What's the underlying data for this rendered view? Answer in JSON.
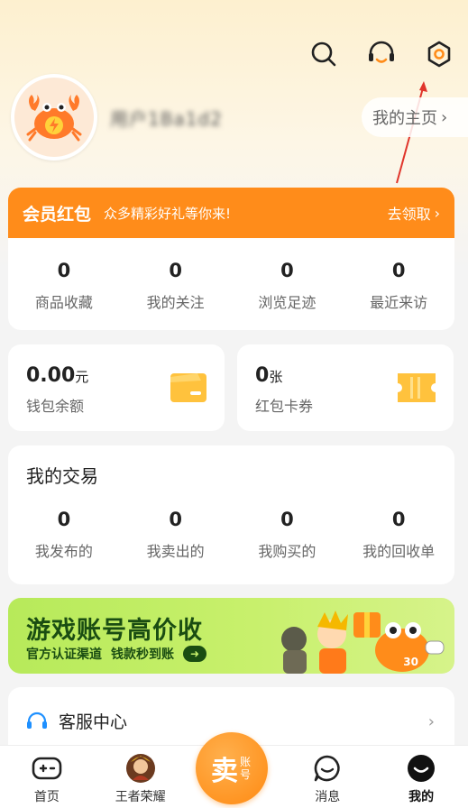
{
  "header": {
    "username": "用户1Ba1d2",
    "homepage_label": "我的主页"
  },
  "icons": {
    "search": "search-icon",
    "service": "headset-icon",
    "settings": "gear-icon"
  },
  "vip": {
    "title": "会员红包",
    "subtitle": "众多精彩好礼等你来!",
    "cta": "去领取"
  },
  "stats": [
    {
      "value": "0",
      "label": "商品收藏"
    },
    {
      "value": "0",
      "label": "我的关注"
    },
    {
      "value": "0",
      "label": "浏览足迹"
    },
    {
      "value": "0",
      "label": "最近来访"
    }
  ],
  "wallet": {
    "balance_value": "0.00",
    "balance_unit": "元",
    "balance_label": "钱包余额",
    "coupon_value": "0",
    "coupon_unit": "张",
    "coupon_label": "红包卡券"
  },
  "trade": {
    "title": "我的交易",
    "items": [
      {
        "value": "0",
        "label": "我发布的"
      },
      {
        "value": "0",
        "label": "我卖出的"
      },
      {
        "value": "0",
        "label": "我购买的"
      },
      {
        "value": "0",
        "label": "我的回收单"
      }
    ]
  },
  "banner": {
    "title": "游戏账号高价收",
    "sub1": "官方认证渠道",
    "sub2": "钱款秒到账",
    "badge": "30"
  },
  "service": {
    "label": "客服中心"
  },
  "tabbar": {
    "tabs": [
      {
        "label": "首页"
      },
      {
        "label": "王者荣耀"
      },
      {
        "label": "消息"
      },
      {
        "label": "我的"
      }
    ],
    "sell_big": "卖",
    "sell_small": "账号"
  },
  "colors": {
    "accent": "#ff8c1a",
    "banner_green": "#c8f06c",
    "banner_text": "#1a4d12"
  }
}
